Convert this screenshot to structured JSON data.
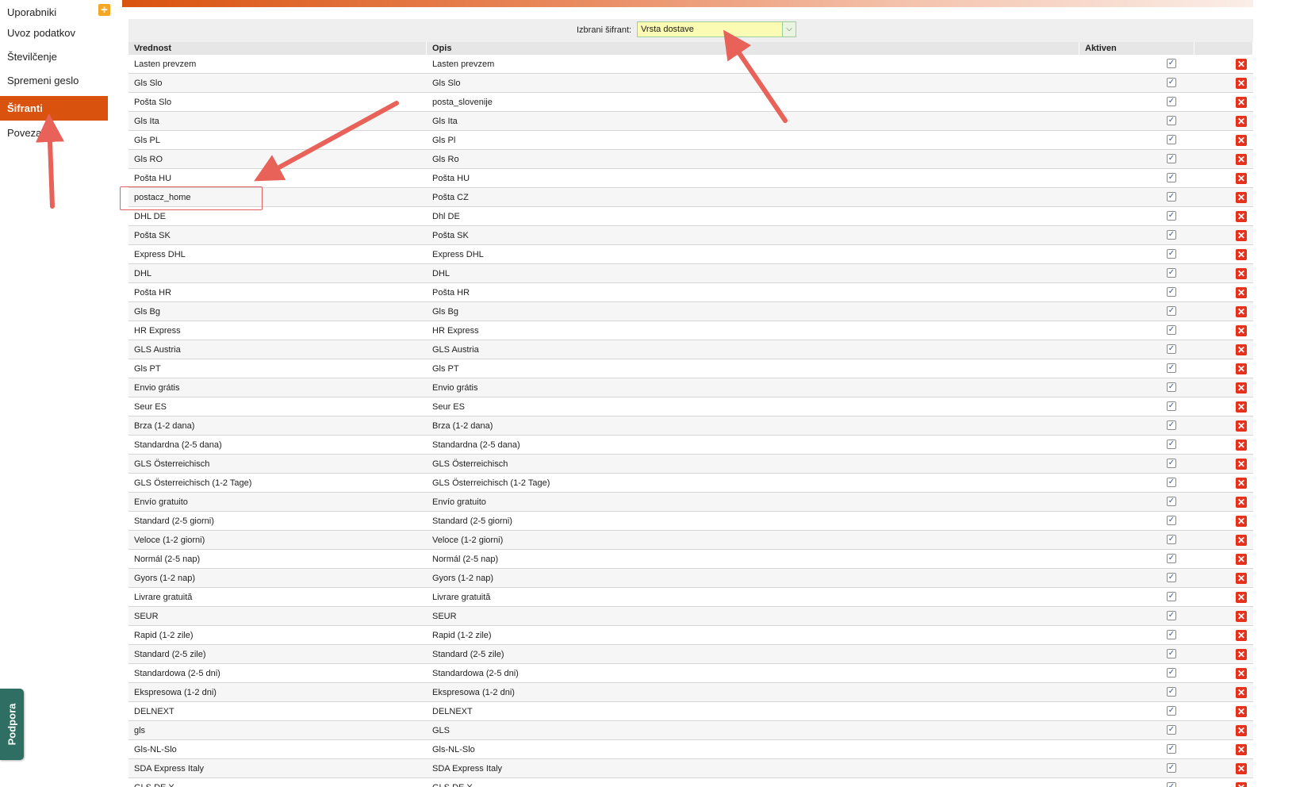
{
  "sidebar": {
    "items": [
      {
        "label": "Uporabniki",
        "active": false
      },
      {
        "label": "Uvoz podatkov",
        "active": false
      },
      {
        "label": "Številčenje",
        "active": false
      },
      {
        "label": "Spremeni geslo",
        "active": false
      },
      {
        "label": "Šifranti",
        "active": true
      },
      {
        "label": "Povezave",
        "active": false
      }
    ],
    "add_icon": "plus-icon",
    "support_label": "Podpora"
  },
  "selector": {
    "label": "Izbrani šifrant:",
    "value": "Vrsta dostave"
  },
  "table": {
    "columns": [
      "Vrednost",
      "Opis",
      "Aktiven"
    ],
    "rows": [
      {
        "value": "Lasten prevzem",
        "desc": "Lasten prevzem",
        "active": true
      },
      {
        "value": "Gls Slo",
        "desc": "Gls Slo",
        "active": true
      },
      {
        "value": "Pošta Slo",
        "desc": "posta_slovenije",
        "active": true
      },
      {
        "value": "Gls Ita",
        "desc": "Gls Ita",
        "active": true
      },
      {
        "value": "Gls PL",
        "desc": "Gls Pl",
        "active": true
      },
      {
        "value": "Gls RO",
        "desc": "Gls Ro",
        "active": true
      },
      {
        "value": "Pošta HU",
        "desc": "Pošta HU",
        "active": true
      },
      {
        "value": "postacz_home",
        "desc": "Pošta CZ",
        "active": true
      },
      {
        "value": "DHL DE",
        "desc": "Dhl DE",
        "active": true
      },
      {
        "value": "Pošta SK",
        "desc": "Pošta SK",
        "active": true
      },
      {
        "value": "Express DHL",
        "desc": "Express DHL",
        "active": true
      },
      {
        "value": "DHL",
        "desc": "DHL",
        "active": true
      },
      {
        "value": "Pošta HR",
        "desc": "Pošta HR",
        "active": true
      },
      {
        "value": "Gls Bg",
        "desc": "Gls Bg",
        "active": true
      },
      {
        "value": "HR Express",
        "desc": "HR Express",
        "active": true
      },
      {
        "value": "GLS Austria",
        "desc": "GLS Austria",
        "active": true
      },
      {
        "value": "Gls PT",
        "desc": "Gls PT",
        "active": true
      },
      {
        "value": "Envio grátis",
        "desc": "Envio grátis",
        "active": true
      },
      {
        "value": "Seur ES",
        "desc": "Seur ES",
        "active": true
      },
      {
        "value": "Brza (1-2 dana)",
        "desc": "Brza (1-2 dana)",
        "active": true
      },
      {
        "value": "Standardna (2-5 dana)",
        "desc": "Standardna (2-5 dana)",
        "active": true
      },
      {
        "value": "GLS Österreichisch",
        "desc": "GLS Österreichisch",
        "active": true
      },
      {
        "value": "GLS Österreichisch (1-2 Tage)",
        "desc": "GLS Österreichisch (1-2 Tage)",
        "active": true
      },
      {
        "value": "Envío gratuito",
        "desc": "Envío gratuito",
        "active": true
      },
      {
        "value": "Standard (2-5 giorni)",
        "desc": "Standard (2-5 giorni)",
        "active": true
      },
      {
        "value": "Veloce (1-2 giorni)",
        "desc": "Veloce (1-2 giorni)",
        "active": true
      },
      {
        "value": "Normál (2-5 nap)",
        "desc": "Normál (2-5 nap)",
        "active": true
      },
      {
        "value": "Gyors (1-2 nap)",
        "desc": "Gyors (1-2 nap)",
        "active": true
      },
      {
        "value": "Livrare gratuită",
        "desc": "Livrare gratuită",
        "active": true
      },
      {
        "value": "SEUR",
        "desc": "SEUR",
        "active": true
      },
      {
        "value": "Rapid (1-2 zile)",
        "desc": "Rapid (1-2 zile)",
        "active": true
      },
      {
        "value": "Standard (2-5 zile)",
        "desc": "Standard (2-5 zile)",
        "active": true
      },
      {
        "value": "Standardowa (2-5 dni)",
        "desc": "Standardowa (2-5 dni)",
        "active": true
      },
      {
        "value": "Ekspresowa (1-2 dni)",
        "desc": "Ekspresowa (1-2 dni)",
        "active": true
      },
      {
        "value": "DELNEXT",
        "desc": "DELNEXT",
        "active": true
      },
      {
        "value": "gls",
        "desc": "GLS",
        "active": true
      },
      {
        "value": "Gls-NL-Slo",
        "desc": "Gls-NL-Slo",
        "active": true
      },
      {
        "value": "SDA Express Italy",
        "desc": "SDA Express Italy",
        "active": true
      },
      {
        "value": "GLS DE X",
        "desc": "GLS DE X",
        "active": true
      }
    ]
  },
  "colors": {
    "accent": "#d9530f",
    "selector_bg": "#fbfbb4",
    "delete": "#e8311b",
    "annotation_arrow": "#e8625a",
    "support_tab": "#2f6f63"
  }
}
